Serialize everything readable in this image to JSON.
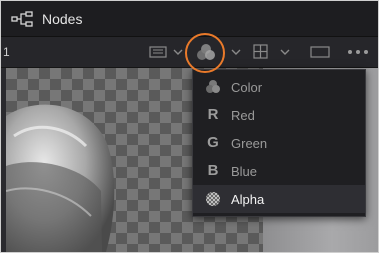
{
  "header": {
    "title": "Nodes",
    "icon": "nodes-icon"
  },
  "toolbar": {
    "title": "1",
    "buttons": [
      {
        "icon": "image-view-icon"
      },
      {
        "icon": "channel-select-icon",
        "highlighted": true
      },
      {
        "icon": "grid-icon"
      },
      {
        "icon": "viewer-mode-icon"
      },
      {
        "icon": "more-options-icon"
      }
    ]
  },
  "channel_menu": {
    "items": [
      {
        "icon": "color-channel-icon",
        "label": "Color",
        "selected": false
      },
      {
        "icon": "R",
        "label": "Red",
        "selected": false
      },
      {
        "icon": "G",
        "label": "Green",
        "selected": false
      },
      {
        "icon": "B",
        "label": "Blue",
        "selected": false
      },
      {
        "icon": "alpha-channel-icon",
        "label": "Alpha",
        "selected": true
      }
    ]
  },
  "colors": {
    "highlight_ring": "#ea7a2a",
    "menu_bg": "#1f1f22",
    "selected_text": "#f2f2f2",
    "unselected_text": "#9a9a9a"
  }
}
